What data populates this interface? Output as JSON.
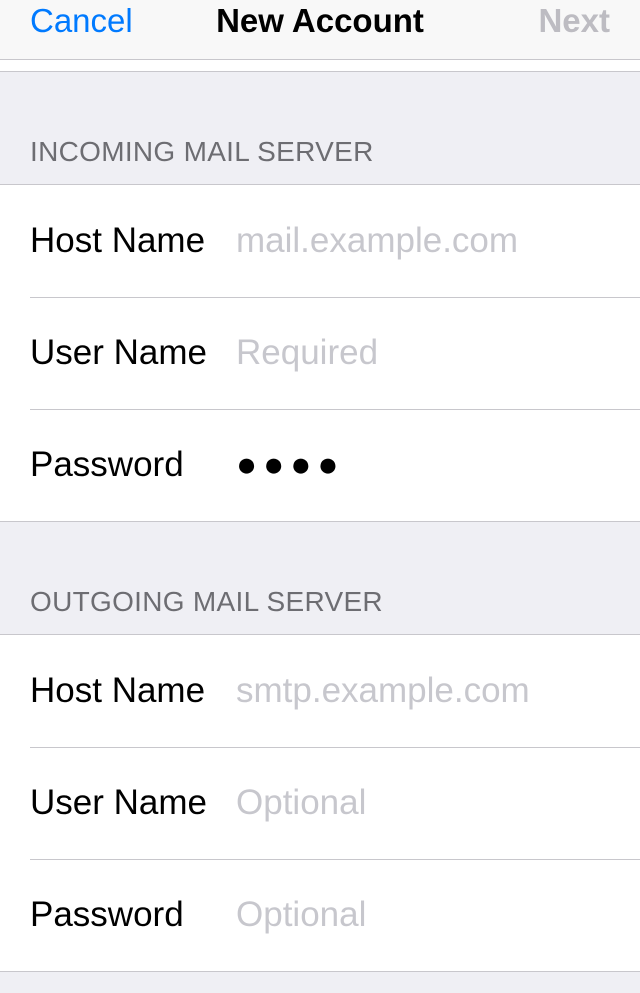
{
  "navbar": {
    "cancel": "Cancel",
    "title": "New Account",
    "next": "Next"
  },
  "incoming": {
    "header": "INCOMING MAIL SERVER",
    "host_label": "Host Name",
    "host_placeholder": "mail.example.com",
    "host_value": "",
    "user_label": "User Name",
    "user_placeholder": "Required",
    "user_value": "",
    "password_label": "Password",
    "password_masked": "●●●●"
  },
  "outgoing": {
    "header": "OUTGOING MAIL SERVER",
    "host_label": "Host Name",
    "host_placeholder": "smtp.example.com",
    "host_value": "",
    "user_label": "User Name",
    "user_placeholder": "Optional",
    "user_value": "",
    "password_label": "Password",
    "password_placeholder": "Optional",
    "password_value": ""
  }
}
